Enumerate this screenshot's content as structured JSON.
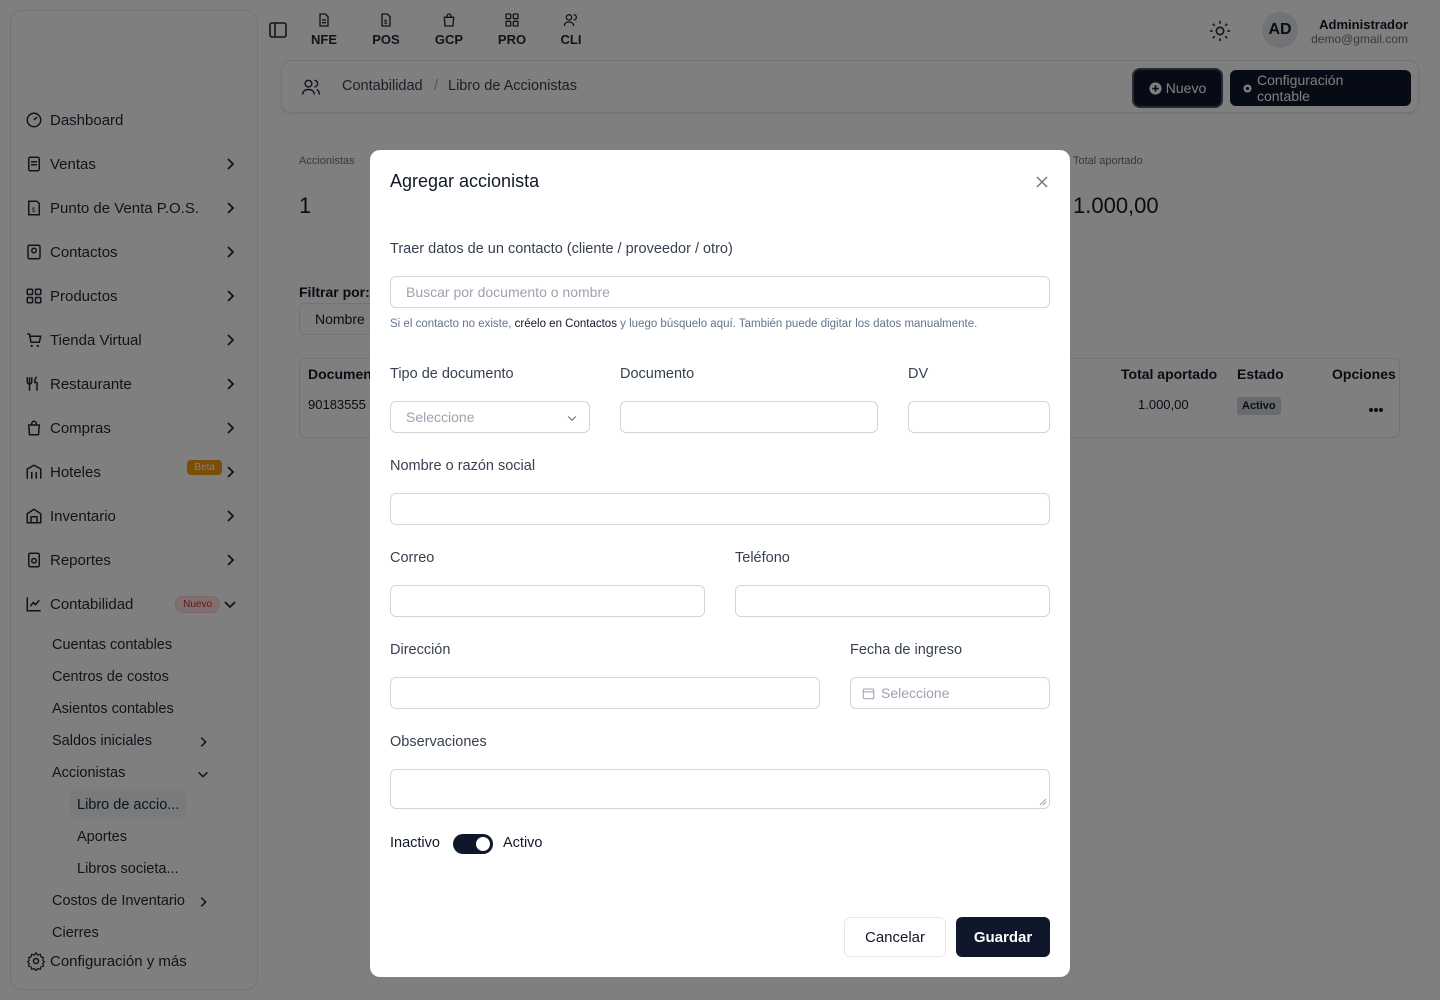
{
  "topbar": {
    "tabs": [
      {
        "label": "NFE",
        "icon": "file-icon"
      },
      {
        "label": "POS",
        "icon": "invoice-icon"
      },
      {
        "label": "GCP",
        "icon": "bag-icon"
      },
      {
        "label": "PRO",
        "icon": "grid-icon"
      },
      {
        "label": "CLI",
        "icon": "users-icon"
      }
    ],
    "avatar_initials": "AD",
    "user_name": "Administrador",
    "user_email": "demo@gmail.com"
  },
  "sidebar": {
    "items": [
      {
        "label": "Dashboard",
        "icon": "gauge-icon"
      },
      {
        "label": "Ventas",
        "icon": "document-icon"
      },
      {
        "label": "Punto de Venta P.O.S.",
        "icon": "pos-icon"
      },
      {
        "label": "Contactos",
        "icon": "contacts-icon"
      },
      {
        "label": "Productos",
        "icon": "grid-icon"
      },
      {
        "label": "Tienda Virtual",
        "icon": "cart-icon"
      },
      {
        "label": "Restaurante",
        "icon": "utensils-icon"
      },
      {
        "label": "Compras",
        "icon": "bag-icon"
      },
      {
        "label": "Hoteles",
        "icon": "hotel-icon",
        "badge": "Beta"
      },
      {
        "label": "Inventario",
        "icon": "warehouse-icon"
      },
      {
        "label": "Reportes",
        "icon": "report-icon"
      },
      {
        "label": "Contabilidad",
        "icon": "chart-icon",
        "badge": "Nuevo"
      }
    ],
    "contabilidad_sub": [
      "Cuentas contables",
      "Centros de costos",
      "Asientos contables",
      "Saldos iniciales",
      "Accionistas"
    ],
    "accionistas_sub": [
      "Libro de accio...",
      "Aportes",
      "Libros societa..."
    ],
    "more_sub": [
      "Costos de Inventario",
      "Cierres"
    ],
    "footer": "Configuración y más"
  },
  "breadcrumb": {
    "items": [
      "Contabilidad",
      "Libro de Accionistas"
    ],
    "new_button": "Nuevo",
    "config_button": "Configuración contable"
  },
  "stats": {
    "accionistas_label": "Accionistas",
    "accionistas_value": "1",
    "total_label": "Total aportado",
    "total_value": "1.000,00"
  },
  "filter": {
    "label": "Filtrar por:",
    "value": "Nombre"
  },
  "table": {
    "headers": [
      "Document",
      "Total aportado",
      "Estado",
      "Opciones"
    ],
    "rows": [
      {
        "documento": "90183555",
        "total": "1.000,00",
        "estado": "Activo"
      }
    ]
  },
  "modal": {
    "title": "Agregar accionista",
    "contact_label": "Traer datos de un contacto (cliente / proveedor / otro)",
    "contact_placeholder": "Buscar por documento o nombre",
    "hint_prefix": "Si el contacto no existe, ",
    "hint_link": "créelo en Contactos",
    "hint_suffix": " y luego búsquelo aquí. También puede digitar los datos manualmente.",
    "tipo_label": "Tipo de documento",
    "tipo_placeholder": "Seleccione",
    "documento_label": "Documento",
    "dv_label": "DV",
    "nombre_label": "Nombre o razón social",
    "correo_label": "Correo",
    "telefono_label": "Teléfono",
    "direccion_label": "Dirección",
    "fecha_label": "Fecha de ingreso",
    "fecha_placeholder": "Seleccione",
    "obs_label": "Observaciones",
    "toggle_off": "Inactivo",
    "toggle_on": "Activo",
    "toggle_state": true,
    "cancel": "Cancelar",
    "save": "Guardar"
  }
}
